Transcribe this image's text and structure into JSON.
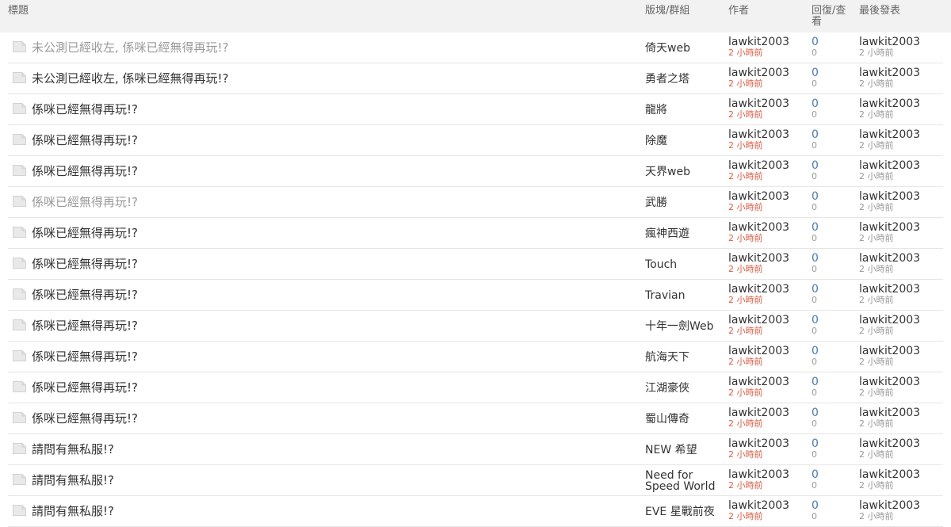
{
  "header": {
    "title": "標題",
    "forum": "版塊/群組",
    "author": "作者",
    "stats": "回復/查看",
    "last_post": "最後發表"
  },
  "colors": {
    "time_accent": "#e05c43",
    "count_link": "#4a78b8",
    "visited_title": "#999999"
  },
  "rows": [
    {
      "title": "未公測已經收左, 係咪已經無得再玩!?",
      "visited": true,
      "forum": "倚天web",
      "author": "lawkit2003",
      "author_time": "2 小時前",
      "replies": "0",
      "views": "0",
      "last_author": "lawkit2003",
      "last_time": "2 小時前"
    },
    {
      "title": "未公測已經收左, 係咪已經無得再玩!?",
      "visited": false,
      "forum": "勇者之塔",
      "author": "lawkit2003",
      "author_time": "2 小時前",
      "replies": "0",
      "views": "0",
      "last_author": "lawkit2003",
      "last_time": "2 小時前"
    },
    {
      "title": "係咪已經無得再玩!?",
      "visited": false,
      "forum": "龍將",
      "author": "lawkit2003",
      "author_time": "2 小時前",
      "replies": "0",
      "views": "0",
      "last_author": "lawkit2003",
      "last_time": "2 小時前"
    },
    {
      "title": "係咪已經無得再玩!?",
      "visited": false,
      "forum": "除魔",
      "author": "lawkit2003",
      "author_time": "2 小時前",
      "replies": "0",
      "views": "0",
      "last_author": "lawkit2003",
      "last_time": "2 小時前"
    },
    {
      "title": "係咪已經無得再玩!?",
      "visited": false,
      "forum": "天界web",
      "author": "lawkit2003",
      "author_time": "2 小時前",
      "replies": "0",
      "views": "0",
      "last_author": "lawkit2003",
      "last_time": "2 小時前"
    },
    {
      "title": "係咪已經無得再玩!?",
      "visited": true,
      "forum": "武勝",
      "author": "lawkit2003",
      "author_time": "2 小時前",
      "replies": "0",
      "views": "0",
      "last_author": "lawkit2003",
      "last_time": "2 小時前"
    },
    {
      "title": "係咪已經無得再玩!?",
      "visited": false,
      "forum": "瘋神西遊",
      "author": "lawkit2003",
      "author_time": "2 小時前",
      "replies": "0",
      "views": "0",
      "last_author": "lawkit2003",
      "last_time": "2 小時前"
    },
    {
      "title": "係咪已經無得再玩!?",
      "visited": false,
      "forum": "Touch",
      "author": "lawkit2003",
      "author_time": "2 小時前",
      "replies": "0",
      "views": "0",
      "last_author": "lawkit2003",
      "last_time": "2 小時前"
    },
    {
      "title": "係咪已經無得再玩!?",
      "visited": false,
      "forum": "Travian",
      "author": "lawkit2003",
      "author_time": "2 小時前",
      "replies": "0",
      "views": "0",
      "last_author": "lawkit2003",
      "last_time": "2 小時前"
    },
    {
      "title": "係咪已經無得再玩!?",
      "visited": false,
      "forum": "十年一劍Web",
      "author": "lawkit2003",
      "author_time": "2 小時前",
      "replies": "0",
      "views": "0",
      "last_author": "lawkit2003",
      "last_time": "2 小時前"
    },
    {
      "title": "係咪已經無得再玩!?",
      "visited": false,
      "forum": "航海天下",
      "author": "lawkit2003",
      "author_time": "2 小時前",
      "replies": "0",
      "views": "0",
      "last_author": "lawkit2003",
      "last_time": "2 小時前"
    },
    {
      "title": "係咪已經無得再玩!?",
      "visited": false,
      "forum": "江湖豪俠",
      "author": "lawkit2003",
      "author_time": "2 小時前",
      "replies": "0",
      "views": "0",
      "last_author": "lawkit2003",
      "last_time": "2 小時前"
    },
    {
      "title": "係咪已經無得再玩!?",
      "visited": false,
      "forum": "蜀山傳奇",
      "author": "lawkit2003",
      "author_time": "2 小時前",
      "replies": "0",
      "views": "0",
      "last_author": "lawkit2003",
      "last_time": "2 小時前"
    },
    {
      "title": "請問有無私服!?",
      "visited": false,
      "forum": "NEW 希望",
      "author": "lawkit2003",
      "author_time": "2 小時前",
      "replies": "0",
      "views": "0",
      "last_author": "lawkit2003",
      "last_time": "2 小時前"
    },
    {
      "title": "請問有無私服!?",
      "visited": false,
      "forum": "Need for Speed World",
      "author": "lawkit2003",
      "author_time": "2 小時前",
      "replies": "0",
      "views": "0",
      "last_author": "lawkit2003",
      "last_time": "2 小時前"
    },
    {
      "title": "請問有無私服!?",
      "visited": false,
      "forum": "EVE 星戰前夜",
      "author": "lawkit2003",
      "author_time": "2 小時前",
      "replies": "0",
      "views": "0",
      "last_author": "lawkit2003",
      "last_time": "2 小時前"
    }
  ]
}
